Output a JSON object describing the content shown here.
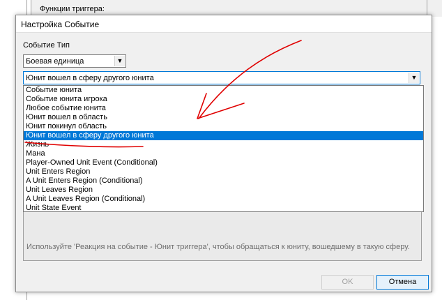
{
  "background": {
    "panel_label": "Функции триггера:"
  },
  "dialog": {
    "title": "Настройка Событие",
    "event_type_label": "Событие Тип",
    "unit_type_value": "Боевая единица",
    "event_value": "Юнит вошел в сферу другого юнита",
    "list_items": [
      "Событие юнита",
      "Событие юнита игрока",
      "Любое событие юнита",
      "Юнит вошел в область",
      "Юнит покинул область",
      "Юнит вошел в сферу другого юнита",
      "Жизнь",
      "Мана",
      "Player-Owned Unit Event (Conditional)",
      "Unit Enters Region",
      "A Unit Enters Region (Conditional)",
      "Unit Leaves Region",
      "A Unit Leaves Region (Conditional)",
      "Unit State Event"
    ],
    "selected_index": 5,
    "description": "Используйте 'Реакция на событие - Юнит триггера', чтобы обращаться к юниту, вошедшему в такую сферу.",
    "ok_label": "OK",
    "cancel_label": "Отмена"
  },
  "icons": {
    "combo_arrow": "chevron-down-icon"
  },
  "colors": {
    "selection": "#0078d7",
    "annotation": "#e00000"
  }
}
